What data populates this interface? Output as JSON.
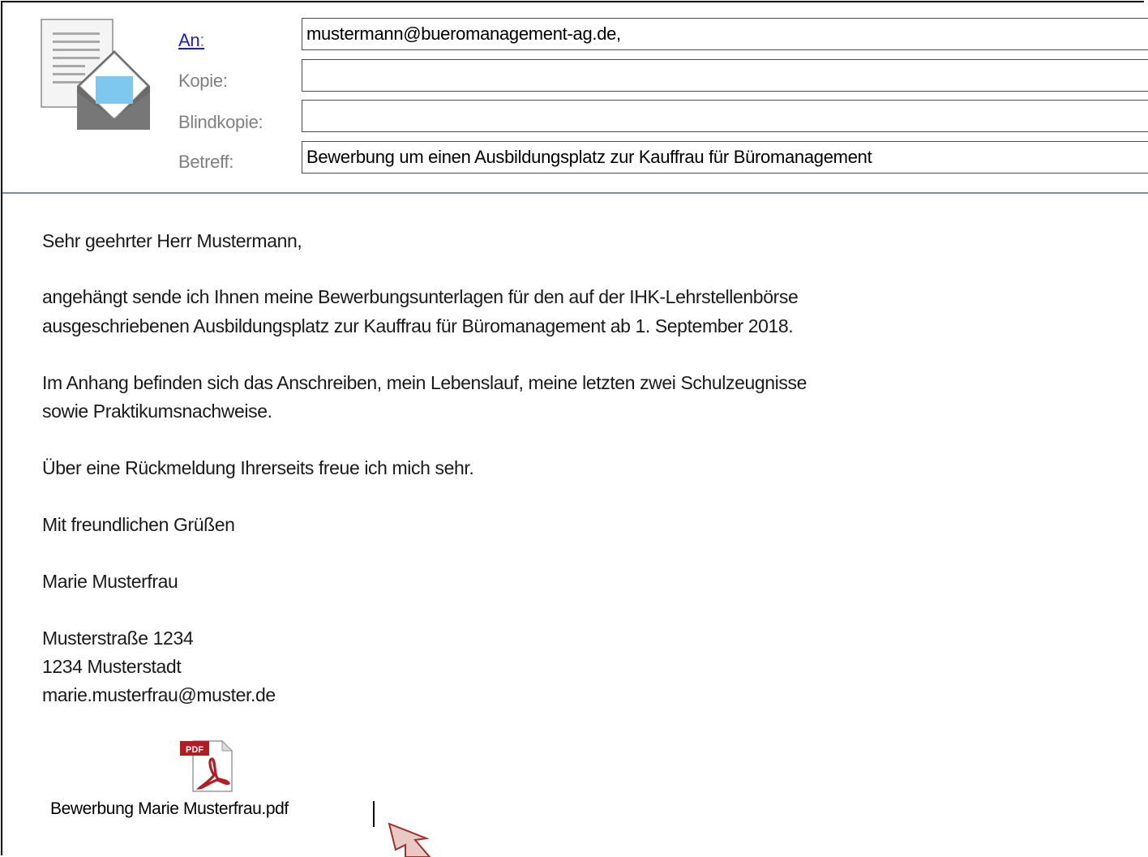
{
  "header": {
    "to_label": "An",
    "to_colon": ":",
    "cc_label": "Kopie:",
    "bcc_label": "Blindkopie:",
    "subject_label": "Betreff:",
    "to_value": "mustermann@bueromanagement-ag.de,",
    "cc_value": "",
    "bcc_value": "",
    "subject_value": "Bewerbung um einen Ausbildungsplatz zur Kauffrau für Büromanagement",
    "icon": "envelope-document-icon"
  },
  "body": {
    "greeting": "Sehr geehrter Herr Mustermann,",
    "para1_line1": "angehängt sende ich Ihnen meine Bewerbungsunterlagen für den auf der IHK-Lehrstellenbörse",
    "para1_line2": "ausgeschriebenen Ausbildungsplatz zur Kauffrau für Büromanagement ab 1. September 2018.",
    "para2_line1": "Im Anhang befinden sich das Anschreiben, mein Lebenslauf, meine letzten zwei Schulzeugnisse",
    "para2_line2": "sowie Praktikumsnachweise.",
    "para3": "Über eine Rückmeldung Ihrerseits freue ich mich sehr.",
    "closing": "Mit freundlichen Grüßen",
    "name": "Marie Musterfrau",
    "street": "Musterstraße 1234",
    "city": "1234 Musterstadt",
    "email": "marie.musterfrau@muster.de"
  },
  "attachment": {
    "icon": "pdf-file-icon",
    "icon_badge": "PDF",
    "filename": "Bewerbung Marie Musterfrau.pdf"
  },
  "colors": {
    "link": "#1a1adb",
    "label": "#808080",
    "separator": "#7a8da6",
    "pdf_red": "#b01e23",
    "pointer": "#e8c9c4",
    "pointer_border": "#a0302a"
  }
}
